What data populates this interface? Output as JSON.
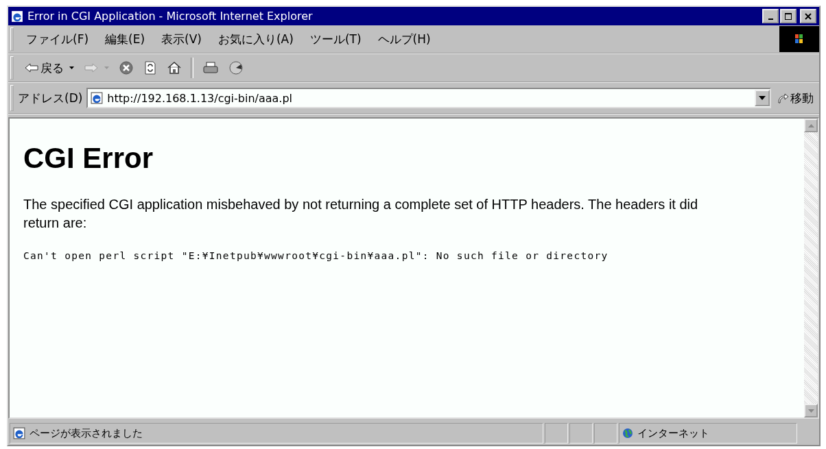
{
  "window": {
    "title": "Error in CGI Application - Microsoft Internet Explorer"
  },
  "menu": [
    "ファイル(F)",
    "編集(E)",
    "表示(V)",
    "お気に入り(A)",
    "ツール(T)",
    "ヘルプ(H)"
  ],
  "toolbar": [
    {
      "kind": "back",
      "label": "戻る"
    },
    {
      "kind": "forward",
      "disabled": true
    },
    {
      "kind": "stop"
    },
    {
      "kind": "refresh"
    },
    {
      "kind": "home"
    },
    {
      "kind": "separator"
    },
    {
      "kind": "print"
    },
    {
      "kind": "media"
    }
  ],
  "address": {
    "label": "アドレス(D)",
    "value": "http://192.168.1.13/cgi-bin/aaa.pl",
    "go": "移動"
  },
  "page": {
    "heading": "CGI Error",
    "message": "The specified CGI application misbehaved by not returning a complete set of HTTP headers. The headers it did return are:",
    "output": "Can't open perl script \"E:¥Inetpub¥wwwroot¥cgi-bin¥aaa.pl\": No such file or directory"
  },
  "status_bar": {
    "text": "ページが表示されました",
    "zone": "インターネット"
  }
}
